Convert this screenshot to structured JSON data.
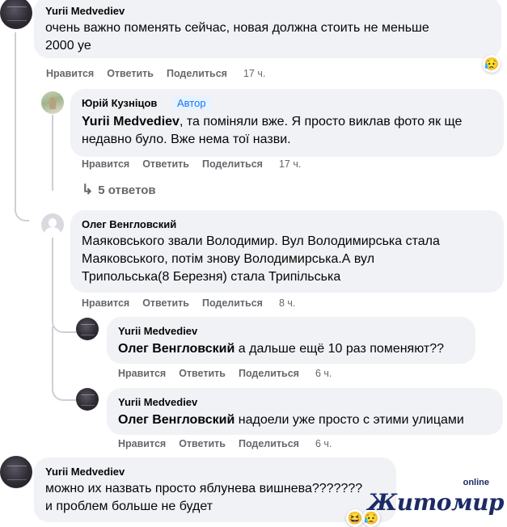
{
  "comments": [
    {
      "author": "Yurii Medvediev",
      "text_lines": [
        "очень важно поменять сейчас, новая должна стоить не меньше",
        "2000 уе"
      ],
      "actions": {
        "like": "Нравится",
        "reply": "Ответить",
        "share": "Поделиться",
        "time": "17 ч."
      },
      "reaction": "sad"
    },
    {
      "author": "Юрій Кузніцов",
      "badge": "Автор",
      "mention": "Yurii Medvediev",
      "text_after_mention": ", та поміняли вже. Я просто виклав фото як ще",
      "text_line2": "недавно було. Вже нема тої назви.",
      "actions": {
        "like": "Нравится",
        "reply": "Ответить",
        "share": "Поделиться",
        "time": "17 ч."
      },
      "replies_link": "5 ответов"
    },
    {
      "author": "Олег Венгловский",
      "text_lines": [
        "Маяковського звали Володимир. Вул Володимирська стала",
        "Маяковського, потім знову Володимирська.А вул",
        "Трипольська(8 Березня) стала Трипільська"
      ],
      "actions": {
        "like": "Нравится",
        "reply": "Ответить",
        "share": "Поделиться",
        "time": "8 ч."
      }
    },
    {
      "author": "Yurii Medvediev",
      "mention": "Олег Венгловский",
      "text_after_mention": " а дальше ещё 10 раз поменяют??",
      "actions": {
        "like": "Нравится",
        "reply": "Ответить",
        "share": "Поделиться",
        "time": "6 ч."
      }
    },
    {
      "author": "Yurii Medvediev",
      "mention": "Олег Венгловский",
      "text_after_mention": " надоели уже просто с этими улицами",
      "actions": {
        "like": "Нравится",
        "reply": "Ответить",
        "share": "Поделиться",
        "time": "6 ч."
      }
    },
    {
      "author": "Yurii Medvediev",
      "text_lines": [
        "можно их назвать просто яблунева вишнева???????",
        "и проблем больше не будет"
      ]
    }
  ],
  "watermark": {
    "main": "Житомир",
    "sup": "online"
  },
  "colors": {
    "bubble": "#f0f2f5",
    "meta": "#65676b",
    "badge_bg": "#e7f3ff",
    "badge_text": "#1877f2",
    "logo": "#1c2a66"
  }
}
